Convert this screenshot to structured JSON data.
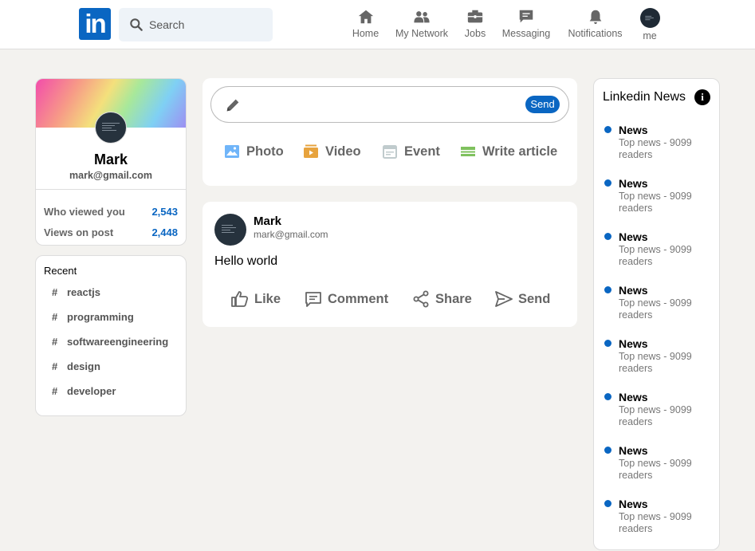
{
  "header": {
    "logo_text": "in",
    "search_placeholder": "Search",
    "nav": [
      {
        "label": "Home",
        "icon": "home-icon"
      },
      {
        "label": "My Network",
        "icon": "people-icon"
      },
      {
        "label": "Jobs",
        "icon": "briefcase-icon"
      },
      {
        "label": "Messaging",
        "icon": "message-icon"
      },
      {
        "label": "Notifications",
        "icon": "bell-icon"
      },
      {
        "label": "me",
        "icon": "avatar"
      }
    ]
  },
  "profile": {
    "name": "Mark",
    "email": "mark@gmail.com",
    "stats": [
      {
        "label": "Who viewed you",
        "value": "2,543"
      },
      {
        "label": "Views on post",
        "value": "2,448"
      }
    ]
  },
  "recent": {
    "title": "Recent",
    "tags": [
      "reactjs",
      "programming",
      "softwareengineering",
      "design",
      "developer"
    ]
  },
  "postbox": {
    "send_label": "Send",
    "actions": [
      {
        "label": "Photo",
        "icon": "photo-icon",
        "color": "#70b5f9"
      },
      {
        "label": "Video",
        "icon": "video-icon",
        "color": "#e7a33e"
      },
      {
        "label": "Event",
        "icon": "calendar-icon",
        "color": "#c0cbcd"
      },
      {
        "label": "Write article",
        "icon": "article-icon",
        "color": "#7fc15e"
      }
    ]
  },
  "post": {
    "name": "Mark",
    "email": "mark@gmail.com",
    "text": "Hello world",
    "actions": [
      {
        "label": "Like",
        "icon": "thumbs-up-icon"
      },
      {
        "label": "Comment",
        "icon": "comment-icon"
      },
      {
        "label": "Share",
        "icon": "share-icon"
      },
      {
        "label": "Send",
        "icon": "send-icon"
      }
    ]
  },
  "news": {
    "title": "Linkedin News",
    "items": [
      {
        "headline": "News",
        "subtitle": "Top news - 9099 readers"
      },
      {
        "headline": "News",
        "subtitle": "Top news - 9099 readers"
      },
      {
        "headline": "News",
        "subtitle": "Top news - 9099 readers"
      },
      {
        "headline": "News",
        "subtitle": "Top news - 9099 readers"
      },
      {
        "headline": "News",
        "subtitle": "Top news - 9099 readers"
      },
      {
        "headline": "News",
        "subtitle": "Top news - 9099 readers"
      },
      {
        "headline": "News",
        "subtitle": "Top news - 9099 readers"
      },
      {
        "headline": "News",
        "subtitle": "Top news - 9099 readers"
      }
    ]
  },
  "colors": {
    "brand": "#0a66c2",
    "background": "#f3f2ef"
  }
}
